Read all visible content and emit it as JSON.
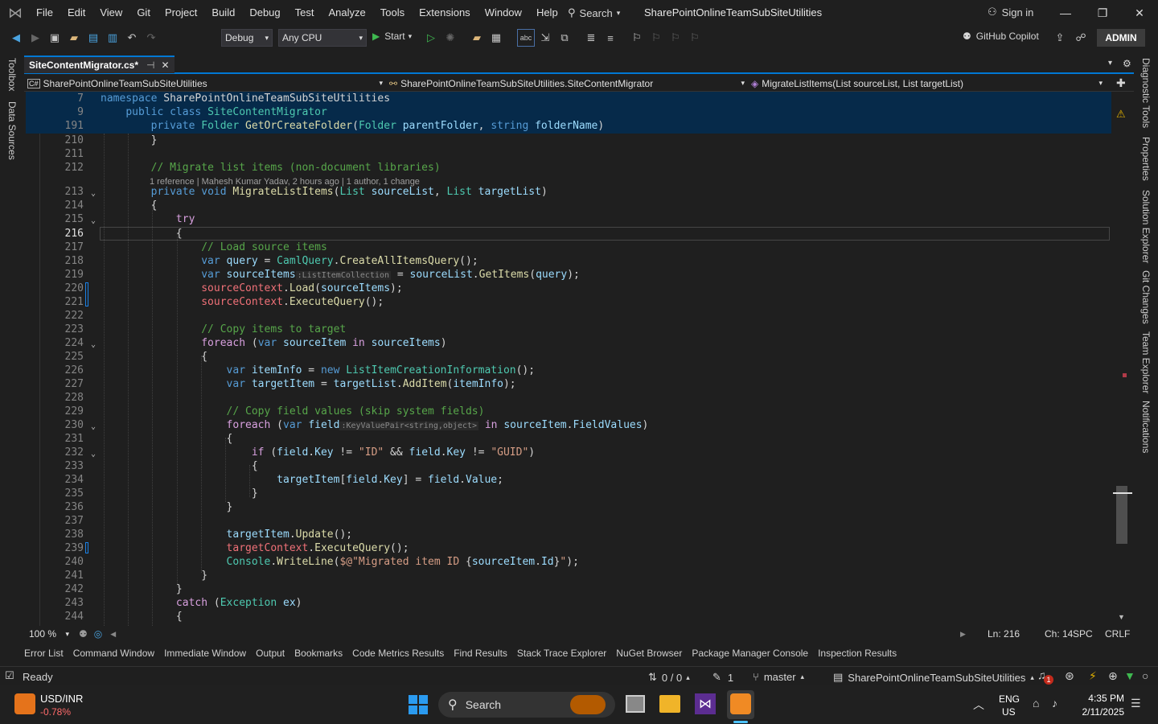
{
  "window": {
    "menu": [
      "File",
      "Edit",
      "View",
      "Git",
      "Project",
      "Build",
      "Debug",
      "Test",
      "Analyze",
      "Tools",
      "Extensions",
      "Window",
      "Help"
    ],
    "search_label": "Search",
    "solution_title": "SharePointOnlineTeamSubSiteUtilities",
    "sign_in": "Sign in"
  },
  "toolbar": {
    "config": "Debug",
    "platform": "Any CPU",
    "start_label": "Start",
    "copilot_label": "GitHub Copilot",
    "admin_label": "ADMIN"
  },
  "left_strip": [
    "Toolbox",
    "Data Sources"
  ],
  "right_strip": [
    "Diagnostic Tools",
    "Properties",
    "Solution Explorer",
    "Git Changes",
    "Team Explorer",
    "Notifications"
  ],
  "tab": {
    "label": "SiteContentMigrator.cs*",
    "pin": "⊣",
    "close": "✕"
  },
  "nav": {
    "project": "SharePointOnlineTeamSubSiteUtilities",
    "class": "SharePointOnlineTeamSubSiteUtilities.SiteContentMigrator",
    "member": "MigrateListItems(List sourceList, List targetList)"
  },
  "sticky": [
    {
      "ln": "7",
      "text": "namespace SharePointOnlineTeamSubSiteUtilities"
    },
    {
      "ln": "9",
      "text": "    public class SiteContentMigrator"
    },
    {
      "ln": "191",
      "text": "        private Folder GetOrCreateFolder(Folder parentFolder, string folderName)"
    }
  ],
  "code_lens": "1 reference | Mahesh Kumar Yadav, 2 hours ago | 1 author, 1 change",
  "lines": [
    {
      "ln": "210"
    },
    {
      "ln": "211"
    },
    {
      "ln": "212"
    },
    {
      "ln": "213"
    },
    {
      "ln": "214"
    },
    {
      "ln": "215"
    },
    {
      "ln": "216"
    },
    {
      "ln": "217"
    },
    {
      "ln": "218"
    },
    {
      "ln": "219"
    },
    {
      "ln": "220"
    },
    {
      "ln": "221"
    },
    {
      "ln": "222"
    },
    {
      "ln": "223"
    },
    {
      "ln": "224"
    },
    {
      "ln": "225"
    },
    {
      "ln": "226"
    },
    {
      "ln": "227"
    },
    {
      "ln": "228"
    },
    {
      "ln": "229"
    },
    {
      "ln": "230"
    },
    {
      "ln": "231"
    },
    {
      "ln": "232"
    },
    {
      "ln": "233"
    },
    {
      "ln": "234"
    },
    {
      "ln": "235"
    },
    {
      "ln": "236"
    },
    {
      "ln": "237"
    },
    {
      "ln": "238"
    },
    {
      "ln": "239"
    },
    {
      "ln": "240"
    },
    {
      "ln": "241"
    },
    {
      "ln": "242"
    },
    {
      "ln": "243"
    },
    {
      "ln": "244"
    }
  ],
  "hints": {
    "list_item_collection": ":ListItemCollection",
    "kvp": ":KeyValuePair<string,object>"
  },
  "editor_status": {
    "zoom": "100 %",
    "ln": "Ln: 216",
    "ch": "Ch: 14",
    "spc": "SPC",
    "crlf": "CRLF"
  },
  "tool_windows": [
    "Error List",
    "Command Window",
    "Immediate Window",
    "Output",
    "Bookmarks",
    "Code Metrics Results",
    "Find Results",
    "Stack Trace Explorer",
    "NuGet Browser",
    "Package Manager Console",
    "Inspection Results"
  ],
  "status": {
    "ready": "Ready",
    "updown": "0 / 0",
    "pencil": "1",
    "branch": "master",
    "repo": "SharePointOnlineTeamSubSiteUtilities",
    "notif_count": "1"
  },
  "taskbar": {
    "ticker": "USD/INR",
    "change": "-0.78%",
    "search": "Search",
    "lang1": "ENG",
    "lang2": "US",
    "time": "4:35 PM",
    "date": "2/11/2025"
  },
  "colors": {
    "accent": "#0078d4",
    "sticky_bg": "#062a4a",
    "keyword": "#569cd6",
    "type": "#4ec9b0",
    "method": "#dcdcaa",
    "comment": "#57a64a",
    "string": "#d69d85"
  }
}
